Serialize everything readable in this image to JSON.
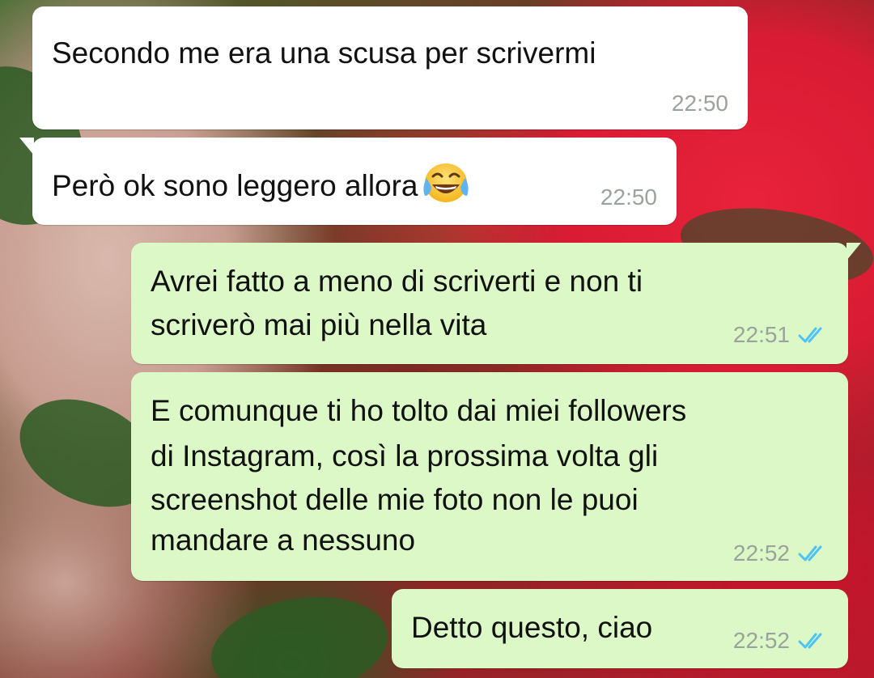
{
  "conversation": {
    "messages": [
      {
        "direction": "incoming",
        "text": "Secondo me era una scusa per scrivermi",
        "time": "22:50"
      },
      {
        "direction": "incoming",
        "text": "Però ok sono leggero allora",
        "emoji": "face-with-tears-of-joy-icon",
        "time": "22:50"
      },
      {
        "direction": "outgoing",
        "lines": [
          "Avrei fatto a meno di scriverti e non ti",
          "scriverò mai più nella vita"
        ],
        "time": "22:51",
        "status": "read"
      },
      {
        "direction": "outgoing",
        "lines": [
          "E comunque ti ho tolto dai miei followers",
          "di Instagram, così la prossima volta gli",
          "screenshot delle mie foto non le puoi",
          "mandare a nessuno"
        ],
        "time": "22:52",
        "status": "read"
      },
      {
        "direction": "outgoing",
        "text": "Detto questo, ciao",
        "time": "22:52",
        "status": "read"
      }
    ]
  },
  "colors": {
    "incoming_bubble": "#ffffff",
    "outgoing_bubble": "#dcf8c6",
    "read_tick": "#4fc3f7",
    "timestamp": "#9aa39c"
  }
}
